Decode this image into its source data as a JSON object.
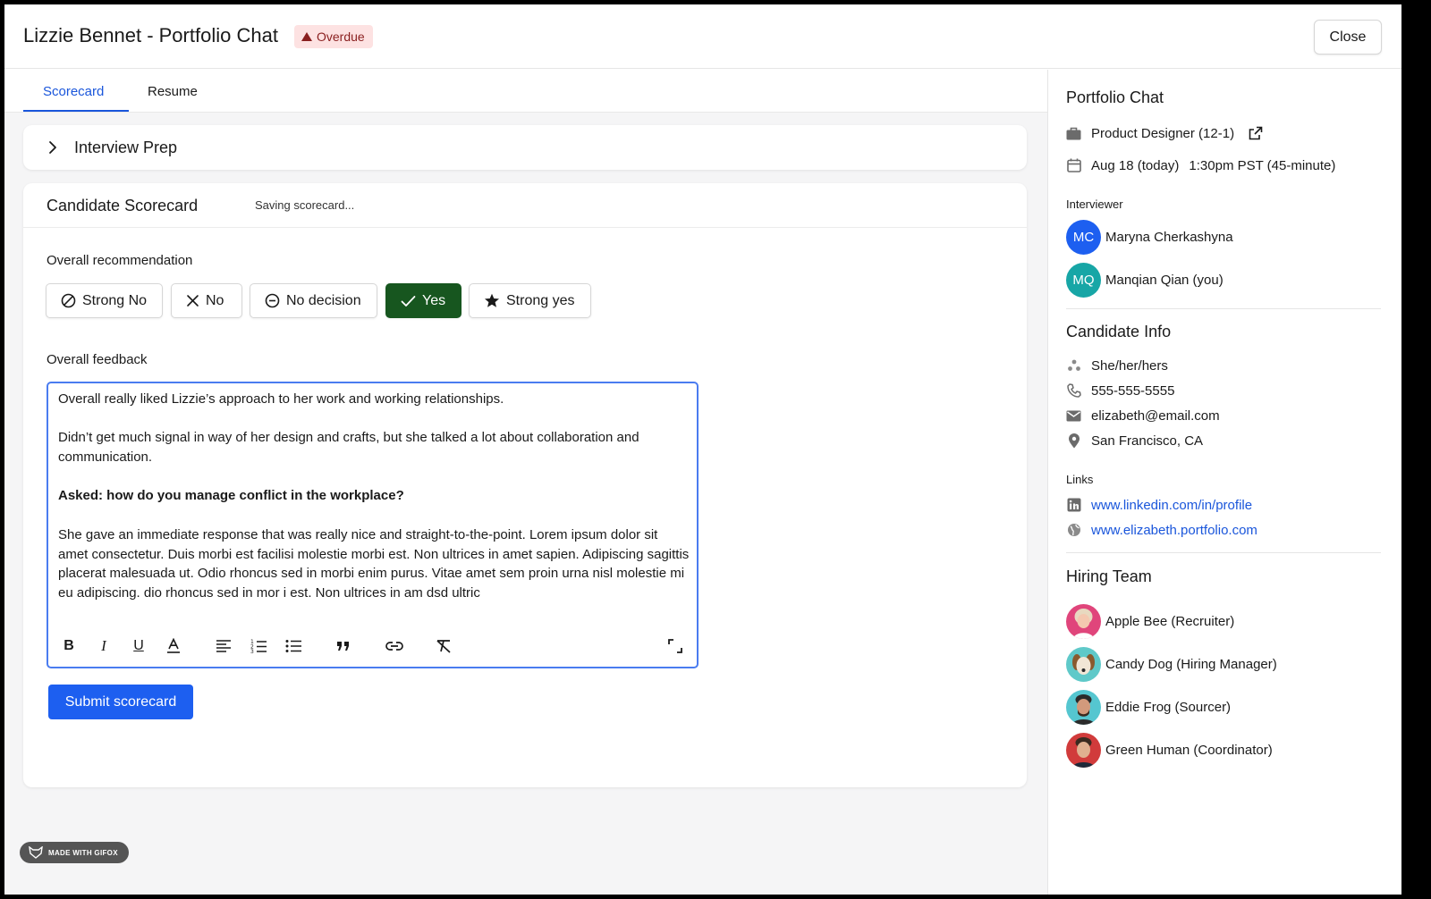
{
  "header": {
    "title": "Lizzie Bennet - Portfolio Chat",
    "badge": "Overdue",
    "close_label": "Close"
  },
  "tabs": [
    {
      "label": "Scorecard",
      "active": true
    },
    {
      "label": "Resume",
      "active": false
    }
  ],
  "prep": {
    "label": "Interview Prep"
  },
  "scorecard": {
    "title": "Candidate Scorecard",
    "status": "Saving scorecard...",
    "recommendation_label": "Overall recommendation",
    "options": [
      {
        "label": "Strong No",
        "icon": "ban-icon"
      },
      {
        "label": "No",
        "icon": "x-icon"
      },
      {
        "label": "No decision",
        "icon": "minus-circle-icon"
      },
      {
        "label": "Yes",
        "icon": "check-icon",
        "selected": true
      },
      {
        "label": "Strong yes",
        "icon": "star-icon"
      }
    ],
    "feedback_label": "Overall feedback",
    "feedback": {
      "p1": "Overall really liked Lizzie’s approach to her work and working relationships.",
      "p2": "Didn’t get much signal in way of her design and crafts, but she talked a lot about collaboration and communication.",
      "p3": "Asked: how do you manage conflict in the workplace?",
      "p4": "She gave an immediate response that was really nice and straight-to-the-point. Lorem ipsum dolor sit amet consectetur. Duis morbi est facilisi molestie morbi est. Non ultrices in amet sapien. Adipiscing sagittis placerat malesuada ut. Odio rhoncus sed in morbi enim purus. Vitae amet sem proin urna nisl molestie mi eu adipiscing. dio rhoncus sed in mor i est. Non ultrices in am dsd ultric"
    },
    "submit_label": "Submit scorecard"
  },
  "watermark": "MADE WITH GIFOX",
  "side": {
    "title": "Portfolio Chat",
    "job": "Product Designer (12-1)",
    "date": "Aug 18 (today)",
    "time": "1:30pm PST (45-minute)",
    "interviewer_label": "Interviewer",
    "interviewers": [
      {
        "initials": "MC",
        "name": "Maryna Cherkashyna",
        "color": "#1d5ff0"
      },
      {
        "initials": "MQ",
        "name": "Manqian Qian (you)",
        "color": "#17a6a6"
      }
    ],
    "candidate_title": "Candidate Info",
    "pronouns": "She/her/hers",
    "phone": "555-555-5555",
    "email": "elizabeth@email.com",
    "location": "San Francisco, CA",
    "links_label": "Links",
    "links": [
      "www.linkedin.com/in/profile",
      "www.elizabeth.portfolio.com"
    ],
    "team_title": "Hiring Team",
    "team": [
      {
        "name": "Apple Bee (Recruiter)",
        "bg": "#e0457b",
        "face": "#f4c8b0",
        "hair": "#e8d9c0"
      },
      {
        "name": "Candy Dog (Hiring Manager)",
        "bg": "#5fc9c9",
        "face": "#d7a26e",
        "hair": "#8a5a2e"
      },
      {
        "name": "Eddie Frog (Sourcer)",
        "bg": "#55c6d0",
        "face": "#d29a7c",
        "hair": "#2b2b2b"
      },
      {
        "name": "Green Human (Coordinator)",
        "bg": "#d13b3b",
        "face": "#e0b090",
        "hair": "#3a2a20"
      }
    ]
  },
  "colors": {
    "accent": "#1a56db",
    "yes_selected": "#17561f",
    "submit": "#1d5ff0",
    "overdue_bg": "#fde2e2",
    "overdue_text": "#8a1f1f"
  }
}
